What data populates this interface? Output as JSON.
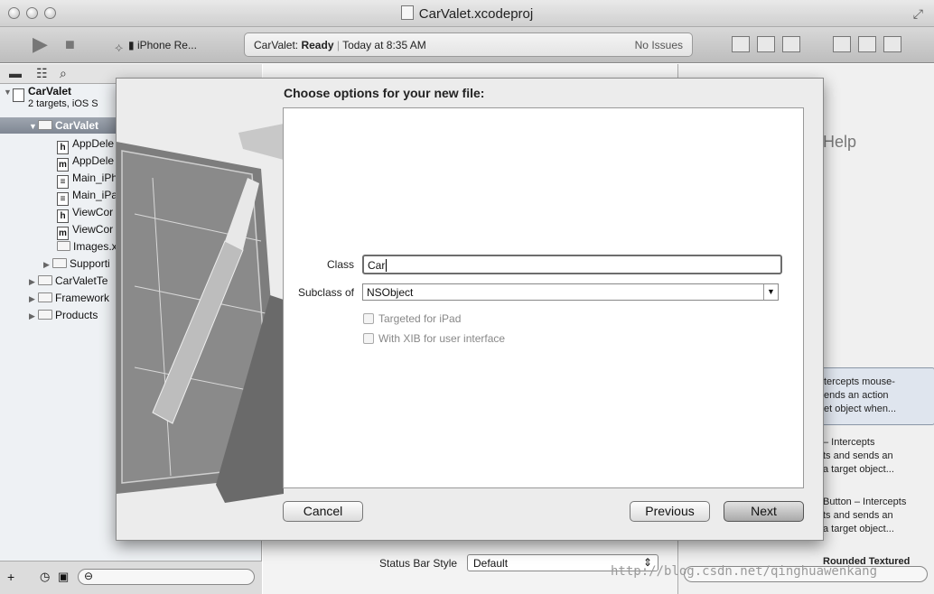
{
  "window": {
    "title": "CarValet.xcodeproj"
  },
  "toolbar": {
    "scheme_device": "iPhone Re...",
    "activity_status_app": "CarValet: ",
    "activity_status_state": "Ready",
    "activity_time": "Today at 8:35 AM",
    "issues": "No Issues"
  },
  "navigator": {
    "project": {
      "name": "CarValet",
      "subtitle": "2 targets, iOS S"
    },
    "items": [
      {
        "label": "CarValet"
      },
      {
        "label": "AppDele",
        "icon": "h"
      },
      {
        "label": "AppDele",
        "icon": "m"
      },
      {
        "label": "Main_iPh",
        "icon": "storyboard"
      },
      {
        "label": "Main_iPa",
        "icon": "storyboard"
      },
      {
        "label": "ViewCor",
        "icon": "h"
      },
      {
        "label": "ViewCor",
        "icon": "m"
      },
      {
        "label": "Images.x",
        "icon": "assets"
      },
      {
        "label": "Supporti"
      },
      {
        "label": "CarValetTe"
      },
      {
        "label": "Framework"
      },
      {
        "label": "Products"
      }
    ]
  },
  "utilities": {
    "help_title": "Help",
    "library": [
      {
        "text": "tercepts mouse-\nends an action\net object when..."
      },
      {
        "text": "– Intercepts\nts and sends an\na target object..."
      },
      {
        "text": "Button – Intercepts\nts and sends an\na target object..."
      },
      {
        "text": "Rounded Textured Button"
      }
    ]
  },
  "sheet": {
    "title": "Choose options for your new file:",
    "class_label": "Class",
    "class_value": "Car",
    "subclass_label": "Subclass of",
    "subclass_value": "NSObject",
    "option_ipad": "Targeted for iPad",
    "option_xib": "With XIB for user interface",
    "cancel": "Cancel",
    "previous": "Previous",
    "next": "Next"
  },
  "editor": {
    "status_bar_style_label": "Status Bar Style",
    "status_bar_style_value": "Default"
  },
  "watermark": "http://blog.csdn.net/qinghuawenkang"
}
